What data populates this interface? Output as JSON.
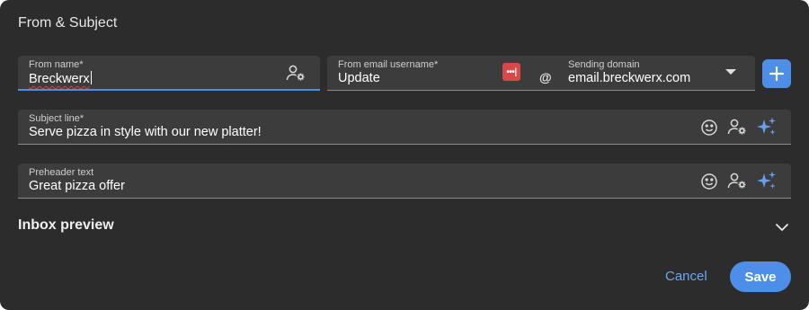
{
  "dialog": {
    "title": "From & Subject"
  },
  "from_name": {
    "label": "From name*",
    "value": "Breckwerx"
  },
  "from_email": {
    "label": "From email username*",
    "value": "Update",
    "password_badge": "•••|",
    "at_symbol": "@",
    "domain_label": "Sending domain",
    "domain_value": "email.breckwerx.com"
  },
  "subject": {
    "label": "Subject line*",
    "value": "Serve pizza in style with our new platter!"
  },
  "preheader": {
    "label": "Preheader text",
    "value": "Great pizza offer"
  },
  "inbox_preview": {
    "label": "Inbox preview"
  },
  "footer": {
    "cancel_label": "Cancel",
    "save_label": "Save"
  },
  "colors": {
    "accent": "#4d8fe8",
    "ai_sparkle": "#6a9ef0",
    "badge_red": "#d94848",
    "background": "#2c2c2c",
    "field": "#3c3c3c"
  },
  "icons": [
    "personalize-icon",
    "password-manager-icon",
    "dropdown-arrow-icon",
    "plus-icon",
    "emoji-icon",
    "ai-sparkle-icon",
    "chevron-down-icon"
  ]
}
